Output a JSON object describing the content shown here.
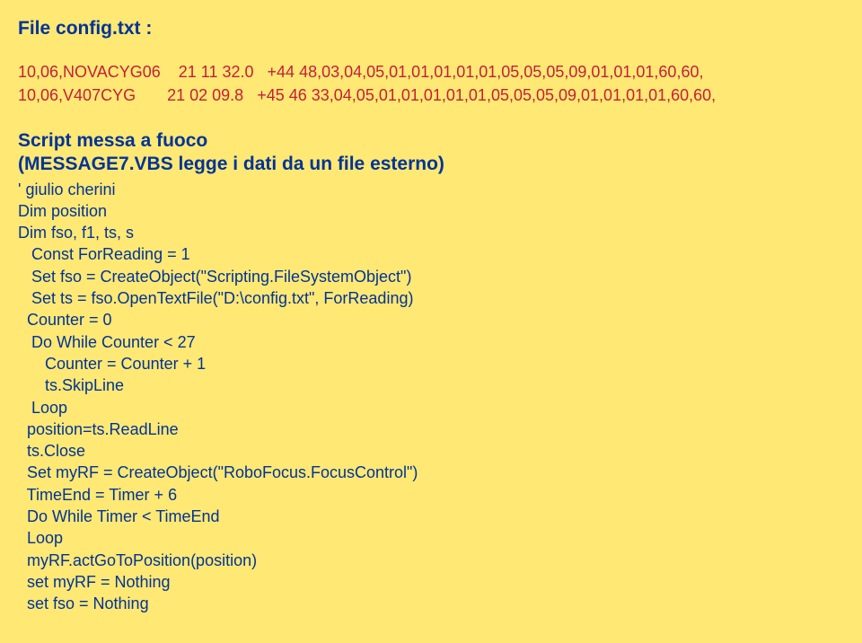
{
  "title": "File config.txt :",
  "data_lines": [
    {
      "col1": "10,06,NOVACYG06",
      "col2": "21 11 32.0",
      "col3": "+44 48,03,04,05,01,01,01,01,01,05,05,05,09,01,01,01,60,60,"
    },
    {
      "col1": "10,06,V407CYG",
      "col2": "21 02 09.8",
      "col3": "+45 46 33,04,05,01,01,01,01,01,05,05,05,09,01,01,01,01,60,60,"
    }
  ],
  "subtitle_line1": "Script messa a fuoco",
  "subtitle_line2": "(MESSAGE7.VBS legge i dati da un file esterno)",
  "code": [
    "' giulio cherini",
    "Dim position",
    "Dim fso, f1, ts, s",
    "   Const ForReading = 1",
    "   Set fso = CreateObject(\"Scripting.FileSystemObject\")",
    "   Set ts = fso.OpenTextFile(\"D:\\config.txt\", ForReading)",
    "  Counter = 0",
    "   Do While Counter < 27",
    "      Counter = Counter + 1",
    "      ts.SkipLine",
    "   Loop",
    "  position=ts.ReadLine",
    "  ts.Close",
    "  Set myRF = CreateObject(\"RoboFocus.FocusControl\")",
    "  TimeEnd = Timer + 6",
    "  Do While Timer < TimeEnd",
    "  Loop",
    "  myRF.actGoToPosition(position)",
    "  set myRF = Nothing",
    "  set fso = Nothing"
  ]
}
